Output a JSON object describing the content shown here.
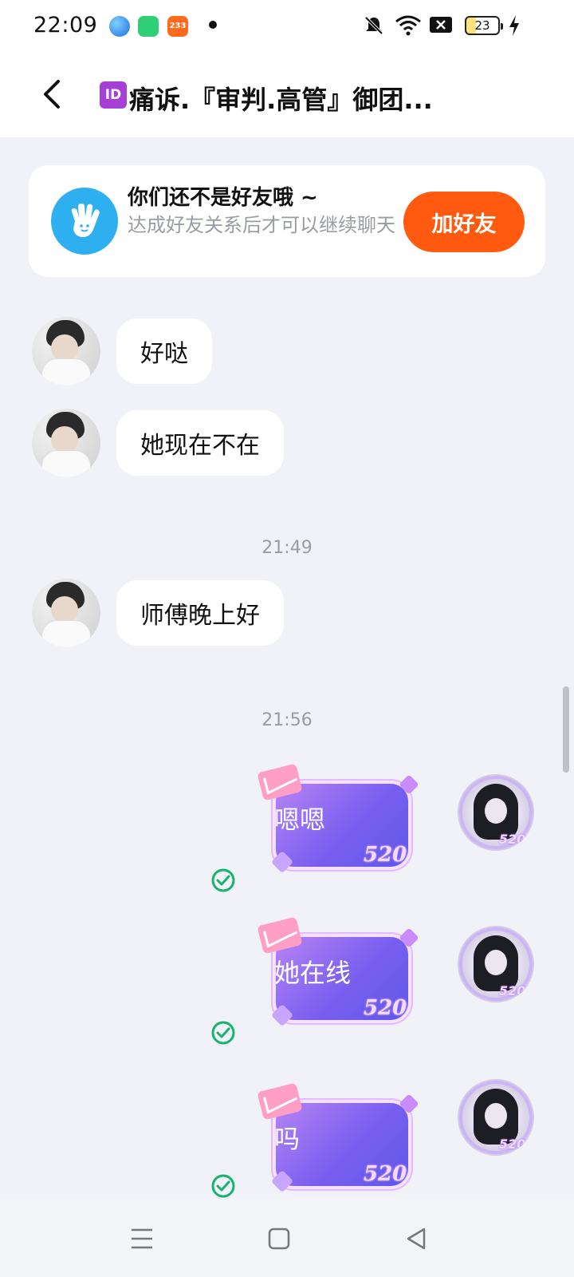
{
  "status_bar": {
    "time": "22:09",
    "app_badge": "233",
    "battery": "23"
  },
  "header": {
    "badge": "ID",
    "title": "痛诉.『审判.高管』御团..."
  },
  "friend_card": {
    "title": "你们还不是好友哦 ~",
    "subtitle": "达成好友关系后才可以继续聊天",
    "add_button": "加好友"
  },
  "messages": [
    {
      "direction": "in",
      "text": "好哒"
    },
    {
      "direction": "in",
      "text": "她现在不在"
    },
    {
      "type": "time",
      "text": "21:49"
    },
    {
      "direction": "in",
      "text": "师傅晚上好"
    },
    {
      "type": "time",
      "text": "21:56"
    },
    {
      "direction": "out",
      "text": "嗯嗯",
      "status": "read"
    },
    {
      "direction": "out",
      "text": "她在线",
      "status": "read"
    },
    {
      "direction": "out",
      "text": "吗",
      "status": "read"
    }
  ],
  "bubble_tag": "520",
  "colors": {
    "accent_orange": "#ff5a0f",
    "hand_blue": "#2eb0f0",
    "bubble_purple": "#7a5ff0",
    "check_green": "#16b36e"
  }
}
